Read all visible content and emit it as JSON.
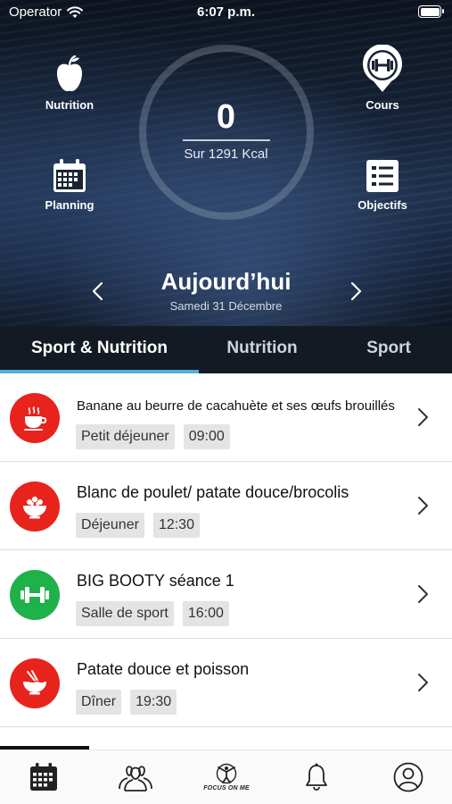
{
  "status_bar": {
    "carrier": "Operator",
    "time": "6:07 p.m."
  },
  "summary": {
    "kcal_consumed": "0",
    "kcal_target": "Sur 1291 Kcal"
  },
  "quick_actions": {
    "nutrition": "Nutrition",
    "cours": "Cours",
    "planning": "Planning",
    "objectifs": "Objectifs"
  },
  "day": {
    "title": "Aujourd’hui",
    "date": "Samedi 31 Décembre"
  },
  "tabs": [
    {
      "label": "Sport & Nutrition",
      "active": true
    },
    {
      "label": "Nutrition",
      "active": false
    },
    {
      "label": "Sport",
      "active": false
    }
  ],
  "entries": [
    {
      "title": "Banane au beurre de cacahuète et ses œufs brouillés",
      "type": "Petit déjeuner",
      "time": "09:00",
      "icon": "coffee-cup-icon",
      "color": "#e8231b"
    },
    {
      "title": "Blanc de poulet/ patate douce/brocolis",
      "type": "Déjeuner",
      "time": "12:30",
      "icon": "salad-bowl-icon",
      "color": "#e8231b"
    },
    {
      "title": "BIG BOOTY séance 1",
      "type": "Salle de sport",
      "time": "16:00",
      "icon": "dumbbell-icon",
      "color": "#1fb14a"
    },
    {
      "title": "Patate douce et poisson",
      "type": "Dîner",
      "time": "19:30",
      "icon": "noodle-bowl-icon",
      "color": "#e8231b"
    }
  ],
  "bottom_nav": {
    "logo_text": "FOCUS ON ME"
  },
  "colors": {
    "accent": "#4fb0d6",
    "meal": "#e8231b",
    "sport": "#1fb14a"
  }
}
